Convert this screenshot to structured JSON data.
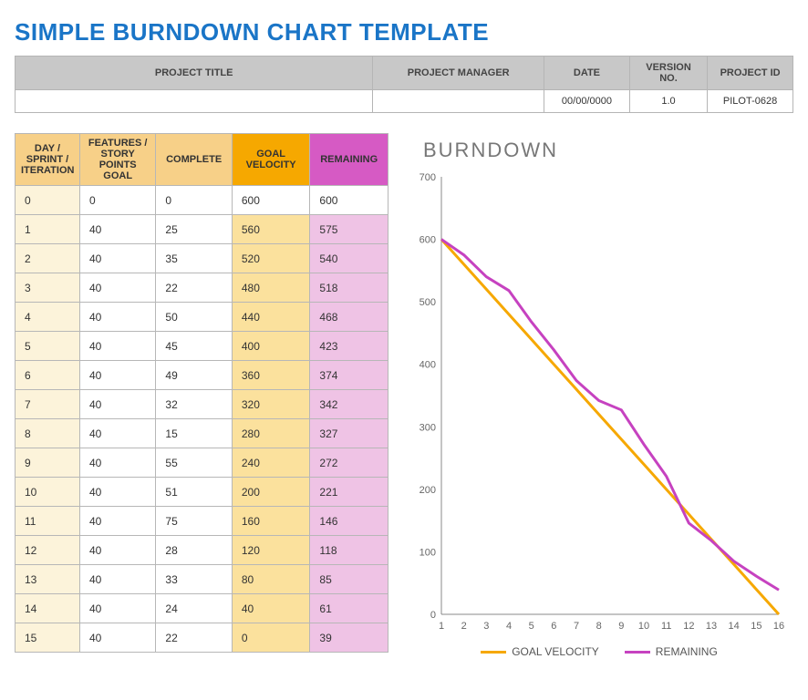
{
  "title": "SIMPLE BURNDOWN CHART TEMPLATE",
  "meta": {
    "headers": {
      "project_title": "PROJECT TITLE",
      "project_manager": "PROJECT MANAGER",
      "date": "DATE",
      "version_no": "VERSION NO.",
      "project_id": "PROJECT ID"
    },
    "values": {
      "project_title": "",
      "project_manager": "",
      "date": "00/00/0000",
      "version_no": "1.0",
      "project_id": "PILOT-0628"
    }
  },
  "table": {
    "headers": {
      "day": "DAY / SPRINT / ITERATION",
      "features": "FEATURES / STORY POINTS GOAL",
      "complete": "COMPLETE",
      "goal_velocity": "GOAL VELOCITY",
      "remaining": "REMAINING"
    },
    "rows": [
      {
        "day": 0,
        "features": 0,
        "complete": 0,
        "goal_velocity": 600,
        "remaining": 600
      },
      {
        "day": 1,
        "features": 40,
        "complete": 25,
        "goal_velocity": 560,
        "remaining": 575
      },
      {
        "day": 2,
        "features": 40,
        "complete": 35,
        "goal_velocity": 520,
        "remaining": 540
      },
      {
        "day": 3,
        "features": 40,
        "complete": 22,
        "goal_velocity": 480,
        "remaining": 518
      },
      {
        "day": 4,
        "features": 40,
        "complete": 50,
        "goal_velocity": 440,
        "remaining": 468
      },
      {
        "day": 5,
        "features": 40,
        "complete": 45,
        "goal_velocity": 400,
        "remaining": 423
      },
      {
        "day": 6,
        "features": 40,
        "complete": 49,
        "goal_velocity": 360,
        "remaining": 374
      },
      {
        "day": 7,
        "features": 40,
        "complete": 32,
        "goal_velocity": 320,
        "remaining": 342
      },
      {
        "day": 8,
        "features": 40,
        "complete": 15,
        "goal_velocity": 280,
        "remaining": 327
      },
      {
        "day": 9,
        "features": 40,
        "complete": 55,
        "goal_velocity": 240,
        "remaining": 272
      },
      {
        "day": 10,
        "features": 40,
        "complete": 51,
        "goal_velocity": 200,
        "remaining": 221
      },
      {
        "day": 11,
        "features": 40,
        "complete": 75,
        "goal_velocity": 160,
        "remaining": 146
      },
      {
        "day": 12,
        "features": 40,
        "complete": 28,
        "goal_velocity": 120,
        "remaining": 118
      },
      {
        "day": 13,
        "features": 40,
        "complete": 33,
        "goal_velocity": 80,
        "remaining": 85
      },
      {
        "day": 14,
        "features": 40,
        "complete": 24,
        "goal_velocity": 40,
        "remaining": 61
      },
      {
        "day": 15,
        "features": 40,
        "complete": 22,
        "goal_velocity": 0,
        "remaining": 39
      }
    ]
  },
  "chart_data": {
    "type": "line",
    "title": "BURNDOWN",
    "xlabel": "",
    "ylabel": "",
    "x": [
      1,
      2,
      3,
      4,
      5,
      6,
      7,
      8,
      9,
      10,
      11,
      12,
      13,
      14,
      15,
      16
    ],
    "series": [
      {
        "name": "GOAL VELOCITY",
        "color": "#f6a800",
        "values": [
          600,
          560,
          520,
          480,
          440,
          400,
          360,
          320,
          280,
          240,
          200,
          160,
          120,
          80,
          40,
          0
        ]
      },
      {
        "name": "REMAINING",
        "color": "#c642c0",
        "values": [
          600,
          575,
          540,
          518,
          468,
          423,
          374,
          342,
          327,
          272,
          221,
          146,
          118,
          85,
          61,
          39
        ]
      }
    ],
    "ylim": [
      0,
      700
    ],
    "yticks": [
      0,
      100,
      200,
      300,
      400,
      500,
      600,
      700
    ],
    "legend_position": "bottom"
  },
  "legend": {
    "goal": "GOAL VELOCITY",
    "remaining": "REMAINING"
  }
}
